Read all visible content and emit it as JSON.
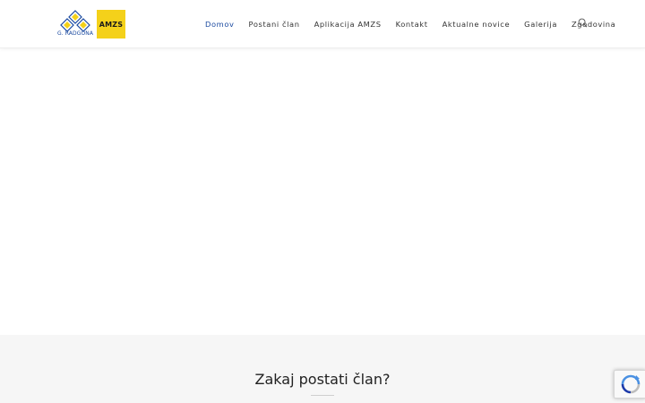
{
  "brand": {
    "city_text": "G. RADGONA",
    "badge_text": "AMZS",
    "badge_color": "#f4d11a",
    "mark_color": "#1b4aa0"
  },
  "nav": {
    "items": [
      {
        "label": "Domov",
        "active": true
      },
      {
        "label": "Postani član",
        "active": false
      },
      {
        "label": "Aplikacija AMZS",
        "active": false
      },
      {
        "label": "Kontakt",
        "active": false
      },
      {
        "label": "Aktualne novice",
        "active": false
      },
      {
        "label": "Galerija",
        "active": false
      },
      {
        "label": "Zgodovina",
        "active": false
      }
    ],
    "search_icon": "search-icon",
    "active_color": "#13aff0"
  },
  "cta": {
    "title": "Zakaj postati član?"
  },
  "recaptcha": {
    "icon": "recaptcha-icon"
  }
}
